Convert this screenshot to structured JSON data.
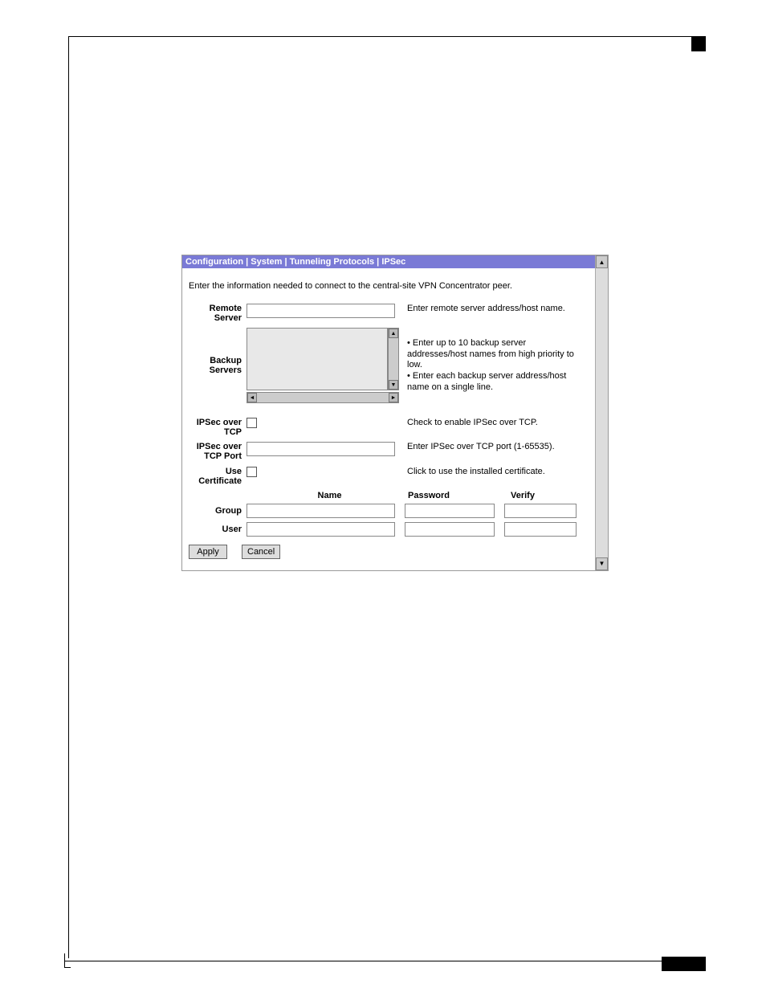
{
  "breadcrumb": "Configuration | System | Tunneling Protocols | IPSec",
  "intro": "Enter the information needed to connect to the central-site VPN Concentrator peer.",
  "fields": {
    "remote_server": {
      "label": "Remote Server",
      "help": "Enter remote server address/host name."
    },
    "backup_servers": {
      "label": "Backup Servers",
      "help1": "Enter up to 10 backup server addresses/host names from high priority to low.",
      "help2": "Enter each backup server address/host name on a single line."
    },
    "ipsec_tcp": {
      "label": "IPSec over TCP",
      "help": "Check to enable IPSec over TCP."
    },
    "ipsec_tcp_port": {
      "label": "IPSec over TCP Port",
      "help": "Enter IPSec over TCP port (1-65535)."
    },
    "use_cert": {
      "label": "Use Certificate",
      "help": "Click to use the installed certificate."
    }
  },
  "cred_headers": {
    "name": "Name",
    "password": "Password",
    "verify": "Verify"
  },
  "cred_rows": {
    "group": "Group",
    "user": "User"
  },
  "buttons": {
    "apply": "Apply",
    "cancel": "Cancel"
  }
}
